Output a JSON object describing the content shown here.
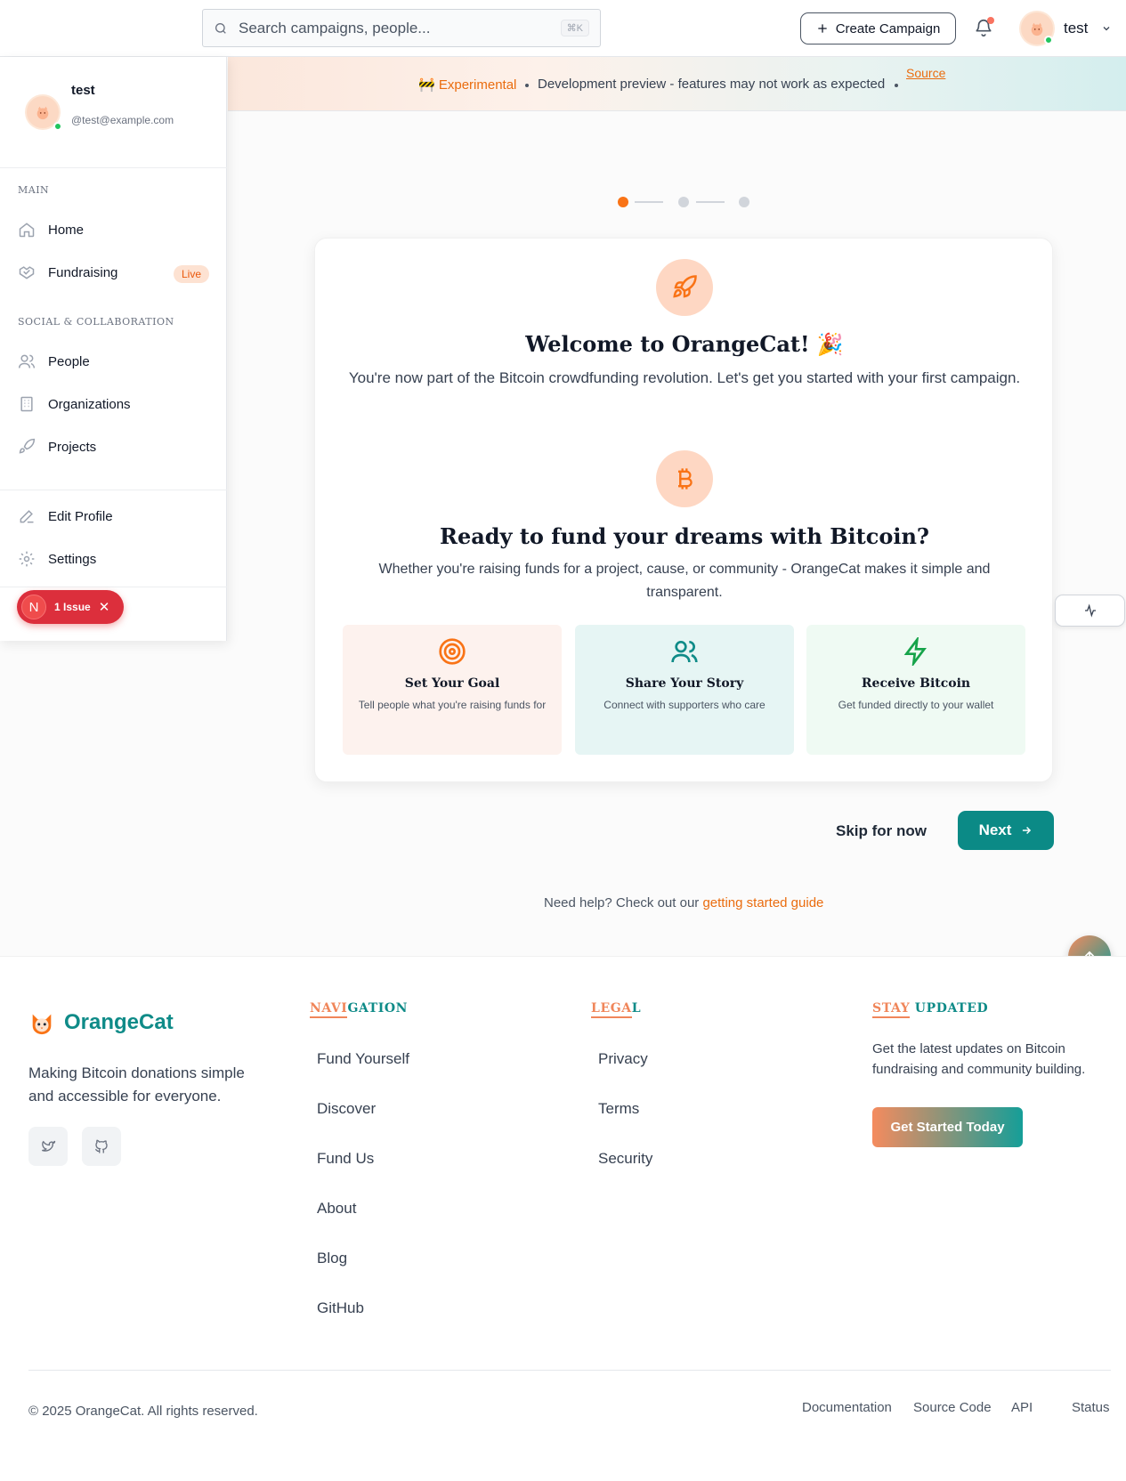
{
  "header": {
    "search_placeholder": "Search campaigns, people...",
    "search_shortcut": "⌘K",
    "create_label": "Create Campaign",
    "user_name": "test"
  },
  "banner": {
    "experimental": "🚧 Experimental",
    "message": "Development preview - features may not work as expected",
    "source": "Source"
  },
  "sidebar": {
    "user_name": "test",
    "user_handle": "@test@example.com",
    "section_main": "MAIN",
    "home": "Home",
    "fundraising": "Fundraising",
    "live_badge": "Live",
    "section_social": "SOCIAL & COLLABORATION",
    "people": "People",
    "organizations": "Organizations",
    "projects": "Projects",
    "edit_profile": "Edit Profile",
    "settings": "Settings"
  },
  "issue_pill": {
    "letter": "N",
    "label": "1 Issue",
    "close": "✕"
  },
  "onboarding": {
    "step_current": 1,
    "step_total": 3,
    "welcome_title": "Welcome to OrangeCat! 🎉",
    "welcome_sub": "You're now part of the Bitcoin crowdfunding revolution. Let's get you started with your first campaign.",
    "ready_title": "Ready to fund your dreams with Bitcoin?",
    "ready_sub": "Whether you're raising funds for a project, cause, or community - OrangeCat makes it simple and transparent.",
    "features": [
      {
        "title": "Set Your Goal",
        "desc": "Tell people what you're raising funds for"
      },
      {
        "title": "Share Your Story",
        "desc": "Connect with supporters who care"
      },
      {
        "title": "Receive Bitcoin",
        "desc": "Get funded directly to your wallet"
      }
    ],
    "skip_label": "Skip for now",
    "next_label": "Next",
    "help_text": "Need help? Check out our",
    "help_link": "getting started guide"
  },
  "footer": {
    "brand": "OrangeCat",
    "tagline": "Making Bitcoin donations simple and accessible for everyone.",
    "nav_heading_a": "NAVI",
    "nav_heading_b": "GATION",
    "nav_links": [
      "Fund Yourself",
      "Discover",
      "Fund Us",
      "About",
      "Blog",
      "GitHub"
    ],
    "legal_heading_a": "LEGA",
    "legal_heading_b": "L",
    "legal_links": [
      "Privacy",
      "Terms",
      "Security"
    ],
    "stay_heading_a": "STAY",
    "stay_heading_b": " UPDATED",
    "stay_text": "Get the latest updates on Bitcoin fundraising and community building.",
    "cta": "Get Started Today",
    "copyright": "© 2025 OrangeCat. All rights reserved.",
    "bottom_links": [
      "Documentation",
      "Source Code",
      "API",
      "Status"
    ]
  },
  "colors": {
    "brand_teal": "#0b8a86",
    "brand_orange": "#ea6c0e",
    "danger": "#dc2f3c"
  }
}
